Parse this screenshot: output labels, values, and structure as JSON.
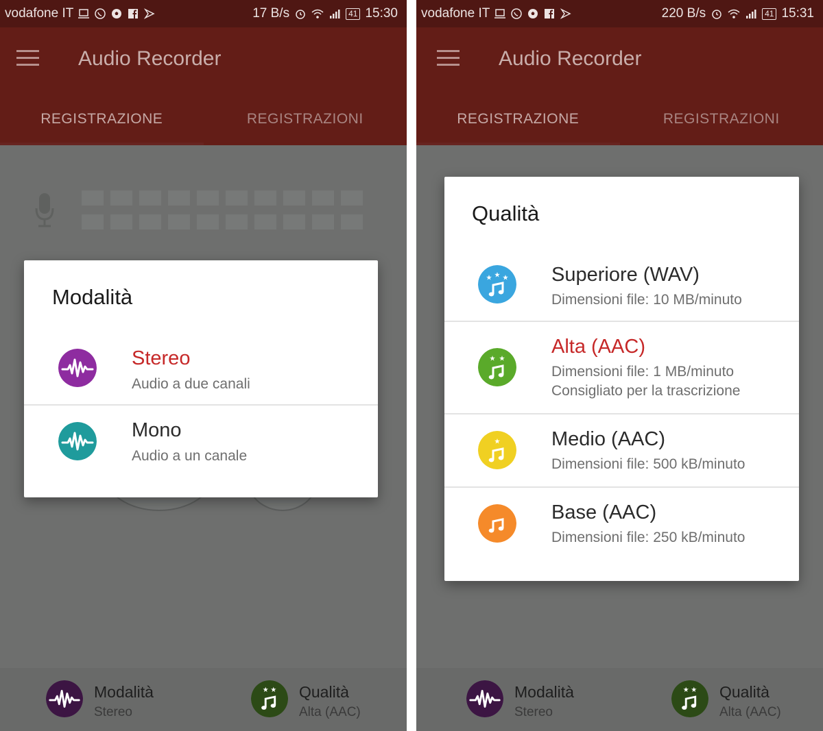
{
  "colors": {
    "status_bar": "#4f1713",
    "app_bar": "#631d17",
    "selected_text": "#c62828",
    "stereo": "#8e2ca0",
    "mono": "#1f9b9c",
    "superiore": "#3aa6df",
    "alta": "#5aaa2a",
    "medio": "#f0d022",
    "base": "#f58a2a"
  },
  "screens": [
    {
      "status_bar": {
        "carrier": "vodafone IT",
        "speed": "17 B/s",
        "battery": "41",
        "time": "15:30"
      },
      "app_title": "Audio Recorder",
      "tabs": [
        "REGISTRAZIONE",
        "REGISTRAZIONI"
      ],
      "dialog": {
        "title": "Modalità",
        "options": [
          {
            "title": "Stereo",
            "subtitle": "Audio a due canali",
            "selected": true,
            "icon": "stereo-wave-icon"
          },
          {
            "title": "Mono",
            "subtitle": "Audio a un canale",
            "selected": false,
            "icon": "mono-wave-icon"
          }
        ]
      },
      "bottom_bar": {
        "mode": {
          "title": "Modalità",
          "value": "Stereo",
          "icon": "stereo-wave-icon"
        },
        "quality": {
          "title": "Qualità",
          "value": "Alta (AAC)",
          "icon": "music-two-stars-icon"
        }
      }
    },
    {
      "status_bar": {
        "carrier": "vodafone IT",
        "speed": "220 B/s",
        "battery": "41",
        "time": "15:31"
      },
      "app_title": "Audio Recorder",
      "tabs": [
        "REGISTRAZIONE",
        "REGISTRAZIONI"
      ],
      "dialog": {
        "title": "Qualità",
        "options": [
          {
            "title": "Superiore (WAV)",
            "subtitle": "Dimensioni file: 10 MB/minuto",
            "selected": false,
            "icon": "music-three-stars-icon"
          },
          {
            "title": "Alta (AAC)",
            "subtitle": "Dimensioni file: 1 MB/minuto",
            "subtitle2": "Consigliato per la trascrizione",
            "selected": true,
            "icon": "music-two-stars-icon"
          },
          {
            "title": "Medio (AAC)",
            "subtitle": "Dimensioni file: 500 kB/minuto",
            "selected": false,
            "icon": "music-one-star-icon"
          },
          {
            "title": "Base (AAC)",
            "subtitle": "Dimensioni file: 250 kB/minuto",
            "selected": false,
            "icon": "music-note-icon"
          }
        ]
      },
      "bottom_bar": {
        "mode": {
          "title": "Modalità",
          "value": "Stereo",
          "icon": "stereo-wave-icon"
        },
        "quality": {
          "title": "Qualità",
          "value": "Alta (AAC)",
          "icon": "music-two-stars-icon"
        }
      }
    }
  ]
}
